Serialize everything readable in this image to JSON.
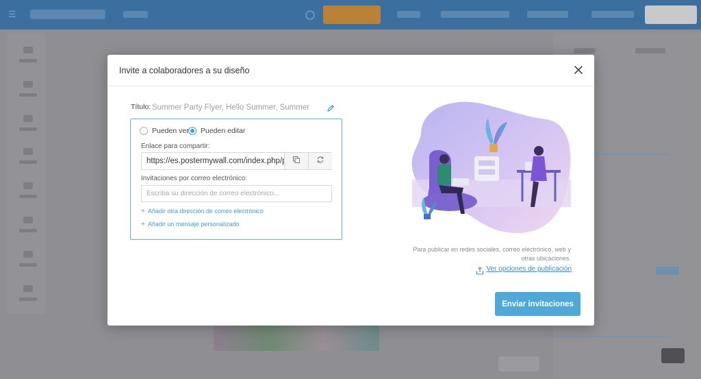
{
  "modal": {
    "title": "Invite a colaboradores a su diseño",
    "title_label": "Título:",
    "title_value": "Summer Party Flyer, Hello Summer, Summer",
    "permissions": {
      "view_label": "Pueden ver",
      "edit_label": "Pueden editar",
      "selected": "edit"
    },
    "share_link_label": "Enlace para compartir:",
    "share_link_value": "https://es.postermywall.com/index.php/p",
    "email_invites_label": "Invitaciones por correo electrónico:",
    "email_placeholder": "Escriba su dirección de correo electrónico...",
    "add_email_link": "Añadir otra dirección de correo electrónico",
    "add_message_link": "Añadir un mensaje personalizado",
    "publish_note": "Para publicar en redes sociales, correo electrónico, web y otras ubicaciones.",
    "publish_link": "Ver opciones de publicación",
    "send_button": "Enviar invitaciones"
  },
  "icons": {
    "close": "close-icon",
    "edit_title": "pencil-icon",
    "copy": "copy-icon",
    "refresh": "refresh-icon",
    "share": "share-icon"
  },
  "colors": {
    "accent": "#3a9fdc",
    "send_button": "#4ea8d8",
    "box_border": "#67b3dd",
    "topbar_dimmed": "#3a6f9f",
    "premium_dimmed": "#b98236"
  }
}
